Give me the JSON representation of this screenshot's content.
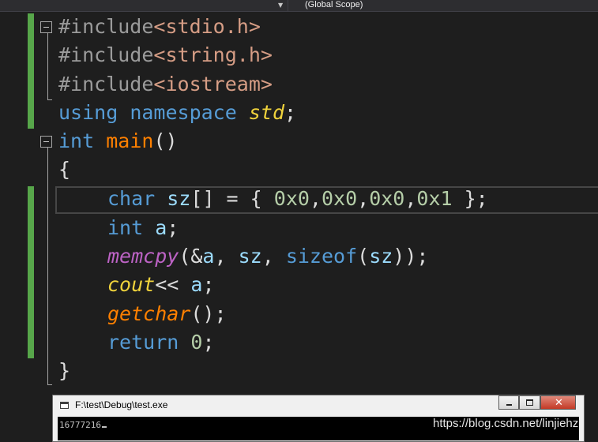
{
  "toolbar": {
    "scope_label": "(Global Scope)"
  },
  "code": {
    "line1": {
      "directive": "#include",
      "header": "<stdio.h>"
    },
    "line2": {
      "directive": "#include",
      "header": "<string.h>"
    },
    "line3": {
      "directive": "#include",
      "header": "<iostream>"
    },
    "line4": {
      "kw1": "using",
      "kw2": "namespace",
      "ns": "std",
      "semi": ";"
    },
    "line5": {
      "type": "int",
      "fn": "main",
      "parens": "()"
    },
    "line6": {
      "brace": "{"
    },
    "line7": {
      "type": "char",
      "var": "sz",
      "rest": "[] = {",
      "v1": "0x0",
      "c1": ",",
      "v2": "0x0",
      "c2": ",",
      "v3": "0x0",
      "c3": ",",
      "v4": "0x1",
      "end": " };"
    },
    "line8": {
      "type": "int",
      "var": "a",
      "semi": ";"
    },
    "line9": {
      "fn": "memcpy",
      "p1": "(&",
      "a": "a",
      "p2": ", ",
      "sz": "sz",
      "p3": ", ",
      "sizeof": "sizeof",
      "p4": "(",
      "sz2": "sz",
      "p5": "));"
    },
    "line10": {
      "fn": "cout",
      "op": "<< ",
      "a": "a",
      "semi": ";"
    },
    "line11": {
      "fn": "getchar",
      "rest": "();"
    },
    "line12": {
      "kw": "return",
      "num": "0",
      "semi": ";"
    },
    "line13": {
      "brace": "}"
    }
  },
  "console": {
    "title": "F:\\test\\Debug\\test.exe",
    "output": "16777216"
  },
  "watermark": "https://blog.csdn.net/linjiehz",
  "colors": {
    "editor_bg": "#1e1e1e",
    "keyword": "#569cd6",
    "include_header": "#d69d85",
    "namespace": "#f0d33c",
    "function": "#ff8000",
    "macro": "#bd63c5",
    "number": "#b5cea8",
    "variable": "#9cdcfe",
    "change_bar": "#57a64a"
  }
}
